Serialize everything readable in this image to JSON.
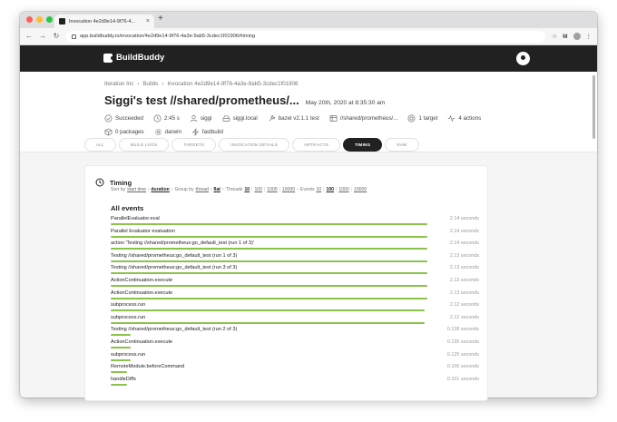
{
  "browser": {
    "tab_title": "Invocation 4e2d9e14-9f76-4...",
    "tab_close": "×",
    "new_tab": "+",
    "back": "←",
    "forward": "→",
    "reload": "↻",
    "url": "app.buildbuddy.io/invocation/4e2d9e14-9f76-4a3e-9ab5-3cdec1f01906#timing",
    "ext_star": "☆",
    "ext_m": "M",
    "ext_menu": "⋮"
  },
  "app": {
    "brand": "BuildBuddy"
  },
  "invocation": {
    "breadcrumb": [
      "Iteration Inc",
      "Builds",
      "Invocation 4e2d9e14-9f76-4a3e-9ab5-3cdec1f01906"
    ],
    "breadcrumb_sep": "›",
    "title": "Siggi's test //shared/prometheus/...",
    "date": "May 20th, 2020 at 8:35:30 am",
    "details": [
      {
        "icon": "check-circle-icon",
        "text": "Succeeded"
      },
      {
        "icon": "clock-icon",
        "text": "2:45 s"
      },
      {
        "icon": "user-icon",
        "text": "siggi"
      },
      {
        "icon": "hard-drive-icon",
        "text": "siggi.local"
      },
      {
        "icon": "wrench-icon",
        "text": "bazel v2.1.1 test"
      },
      {
        "icon": "layers-icon",
        "text": "//shared/prometheus/..."
      },
      {
        "icon": "target-icon",
        "text": "1 target"
      },
      {
        "icon": "activity-icon",
        "text": "4 actions"
      },
      {
        "icon": "package-icon",
        "text": "0 packages"
      },
      {
        "icon": "gear-icon",
        "text": "darwin"
      },
      {
        "icon": "zap-icon",
        "text": "fastbuild"
      }
    ]
  },
  "tabs": [
    {
      "label": "ALL",
      "active": false
    },
    {
      "label": "BUILD LOGS",
      "active": false
    },
    {
      "label": "TARGETS",
      "active": false
    },
    {
      "label": "INVOCATION DETAILS",
      "active": false
    },
    {
      "label": "ARTIFACTS",
      "active": false
    },
    {
      "label": "TIMING",
      "active": true
    },
    {
      "label": "RAW",
      "active": false
    }
  ],
  "timing": {
    "title": "Timing",
    "sort_label": "Sort by",
    "sort_start": "start time",
    "sort_duration": "duration",
    "group_label": "Group by",
    "group_thread": "thread",
    "group_flat": "flat",
    "threads_label": "Threads",
    "threads_options": [
      "10",
      "100",
      "1000",
      "10000"
    ],
    "threads_selected": "10",
    "events_label": "Events",
    "events_options": [
      "10",
      "100",
      "1000",
      "10000"
    ],
    "events_selected": "100",
    "sep": "|",
    "bullet": "•",
    "section_title": "All events",
    "events": [
      {
        "name": "ParallelEvaluator.eval",
        "duration": "2.14 seconds",
        "pct": 0.97
      },
      {
        "name": "Parallel Evaluator evaluation",
        "duration": "2.14 seconds",
        "pct": 0.97
      },
      {
        "name": "action 'Testing //shared/prometheus:go_default_test (run 1 of 3)'",
        "duration": "2.14 seconds",
        "pct": 0.97
      },
      {
        "name": "Testing //shared/prometheus:go_default_test (run 1 of 3)",
        "duration": "2.13 seconds",
        "pct": 0.97
      },
      {
        "name": "Testing //shared/prometheus:go_default_test (run 3 of 3)",
        "duration": "2.13 seconds",
        "pct": 0.97
      },
      {
        "name": "ActionContinuation.execute",
        "duration": "2.13 seconds",
        "pct": 0.97
      },
      {
        "name": "ActionContinuation.execute",
        "duration": "2.13 seconds",
        "pct": 0.97
      },
      {
        "name": "subprocess.run",
        "duration": "2.12 seconds",
        "pct": 0.96
      },
      {
        "name": "subprocess.run",
        "duration": "2.12 seconds",
        "pct": 0.96
      },
      {
        "name": "Testing //shared/prometheus:go_default_test (run 2 of 3)",
        "duration": "0.138 seconds",
        "pct": 0.06
      },
      {
        "name": "ActionContinuation.execute",
        "duration": "0.135 seconds",
        "pct": 0.06
      },
      {
        "name": "subprocess.run",
        "duration": "0.125 seconds",
        "pct": 0.06
      },
      {
        "name": "RemoteModule.beforeCommand",
        "duration": "0.106 seconds",
        "pct": 0.05
      },
      {
        "name": "handleDiffs",
        "duration": "0.101 seconds",
        "pct": 0.05
      }
    ]
  },
  "colors": {
    "header_bg": "#212121",
    "bar_green": "#8bc34a",
    "active_tab": "#212121"
  }
}
